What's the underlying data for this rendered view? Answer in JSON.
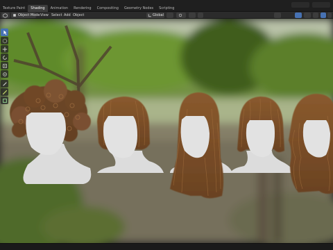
{
  "workspace_tabs": [
    "Texture Paint",
    "Shading",
    "Animation",
    "Rendering",
    "Compositing",
    "Geometry Nodes",
    "Scripting"
  ],
  "active_tab": "Shading",
  "header": {
    "mode": "Object Mode",
    "menus": [
      "View",
      "Select",
      "Add",
      "Object"
    ],
    "orientation": "Global"
  },
  "tools": [
    "cursor-icon",
    "select-box-icon",
    "move-icon",
    "rotate-icon",
    "scale-icon",
    "transform-icon",
    "annotate-icon",
    "measure-icon",
    "add-cube-icon"
  ],
  "colors": {
    "accent": "#4772b3",
    "tab_active": "#3d3d3d",
    "header_bg": "#2b2b2b"
  }
}
